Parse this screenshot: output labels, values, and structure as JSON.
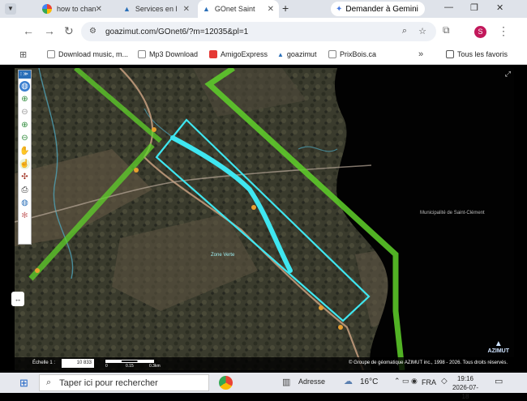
{
  "browser": {
    "tabs": [
      {
        "label": "how to chan"
      },
      {
        "label": "Services en l"
      },
      {
        "label": "GOnet Saint"
      }
    ],
    "gemini_label": "Demander à Gemini",
    "url": "goazimut.com/GOnet6/?m=12035&pl=1",
    "profile_initial": "S",
    "bookmarks": [
      {
        "label": "Download music, m..."
      },
      {
        "label": "Mp3 Download"
      },
      {
        "label": "AmigoExpress"
      },
      {
        "label": "goazimut"
      },
      {
        "label": "PrixBois.ca"
      }
    ],
    "all_favorites_label": "Tous les favoris"
  },
  "map": {
    "municipality_label": "Municipalité de Saint-Clément",
    "zone_label": "Zone Verte",
    "scale_label": "Échelle 1 :",
    "scale_value": "10 833",
    "scale_ticks": [
      "0",
      "0.15",
      "0.3km"
    ],
    "copyright": "© Groupe de géomatique AZIMUT inc., 1998 - 2026. Tous droits réservés.",
    "brand": "AZIMUT",
    "colors": {
      "parcel": "#3fe6f0",
      "zone": "#5fd12a",
      "road": "#c8a080"
    }
  },
  "taskbar": {
    "search_placeholder": "Taper ici pour rechercher",
    "address_label": "Adresse",
    "temperature": "16°C",
    "language": "FRA",
    "time": "19:16",
    "date": "2026-07-18"
  }
}
